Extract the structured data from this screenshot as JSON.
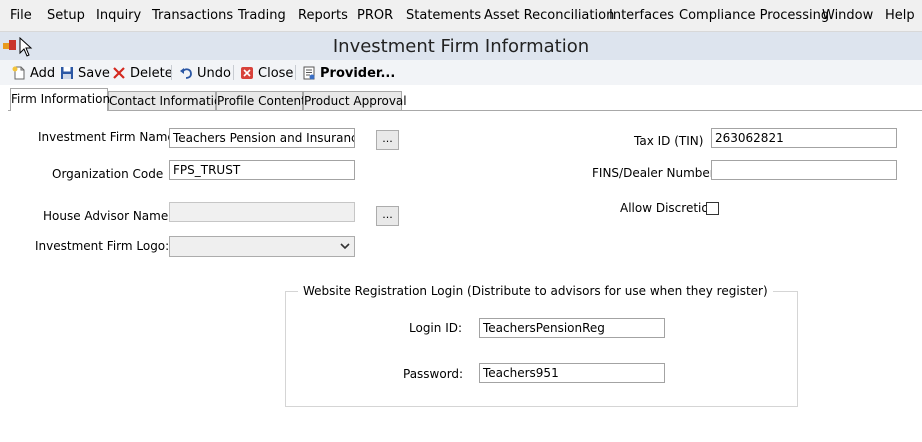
{
  "menu": [
    "File",
    "Setup",
    "Inquiry",
    "Transactions",
    "Trading",
    "Reports",
    "PROR",
    "Statements",
    "Asset Reconciliation",
    "Interfaces",
    "Compliance Processing",
    "Window",
    "Help"
  ],
  "window": {
    "title": "Investment Firm Information"
  },
  "toolbar": {
    "add": "Add",
    "save": "Save",
    "delete": "Delete",
    "undo": "Undo",
    "close": "Close",
    "provider": "Provider..."
  },
  "tabs": [
    "Firm Information",
    "Contact Information",
    "Profile Content",
    "Product Approval"
  ],
  "form": {
    "firm_name_label": "Investment Firm Name",
    "firm_name_value": "Teachers Pension and Insurance Serv",
    "org_code_label": "Organization Code",
    "org_code_value": "FPS_TRUST",
    "house_advisor_label": "House Advisor Name",
    "house_advisor_value": "",
    "logo_label": "Investment Firm Logo:",
    "logo_value": "",
    "tax_id_label": "Tax ID (TIN)",
    "tax_id_value": "263062821",
    "fins_label": "FINS/Dealer Number",
    "fins_value": "",
    "allow_discretion_label": "Allow Discretion",
    "allow_discretion_checked": false,
    "ellipsis": "..."
  },
  "website_login": {
    "legend": "Website Registration Login   (Distribute to advisors for use when they register)",
    "login_label": "Login ID:",
    "login_value": "TeachersPensionReg",
    "password_label": "Password:",
    "password_value": "Teachers951"
  }
}
